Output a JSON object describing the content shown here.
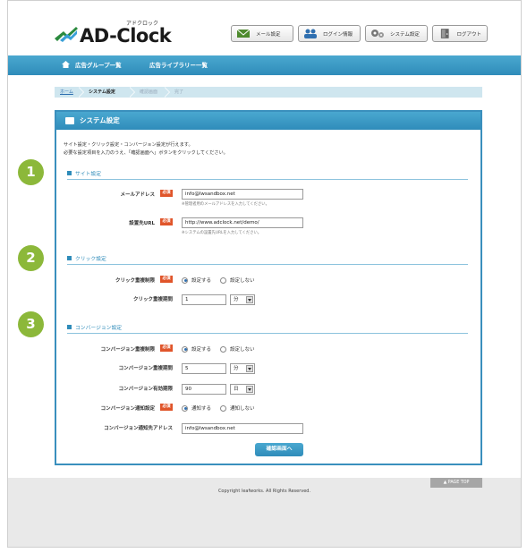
{
  "header": {
    "logo_kana": "アドクロック",
    "logo_text": "AD-Clock",
    "buttons": {
      "mail": "メール設定",
      "login": "ログイン情報",
      "system": "システム設定",
      "logout": "ログアウト"
    }
  },
  "nav": {
    "ad_groups": "広告グループ一覧",
    "ad_library": "広告ライブラリー一覧"
  },
  "breadcrumb": {
    "home": "ホーム",
    "system": "システム設定",
    "confirm": "確認画面",
    "done": "完了"
  },
  "panel": {
    "title": "システム設定",
    "intro_line1": "サイト設定・クリック設定・コンバージョン設定が行えます。",
    "intro_line2": "必要な設定項目を入力のうえ、「確認画面へ」ボタンをクリックしてください。"
  },
  "required_label": "必須",
  "site": {
    "section_title": "サイト設定",
    "mail_label": "メールアドレス",
    "mail_value": "info@lwsandbox.net",
    "mail_note": "※管理者用のメールアドレスを入力してください。",
    "url_label": "設置先URL",
    "url_value": "http://www.adclock.net/demo/",
    "url_note": "※システムの設置先URLを入力してください。"
  },
  "click": {
    "section_title": "クリック設定",
    "dup_label": "クリック重複制限",
    "opt_on": "設定する",
    "opt_off": "設定しない",
    "period_label": "クリック重複期間",
    "period_value": "1",
    "period_unit": "分"
  },
  "conversion": {
    "section_title": "コンバージョン設定",
    "dup_label": "コンバージョン重複制限",
    "opt_on": "設定する",
    "opt_off": "設定しない",
    "period_label": "コンバージョン重複期間",
    "period_value": "5",
    "period_unit": "分",
    "valid_label": "コンバージョン有効期限",
    "valid_value": "90",
    "valid_unit": "日",
    "notify_label": "コンバージョン通知設定",
    "notify_on": "通知する",
    "notify_off": "通知しない",
    "notify_mail_label": "コンバージョン通知先アドレス",
    "notify_mail_value": "info@lwsandbox.net"
  },
  "confirm_button": "確認画面へ",
  "badges": [
    "1",
    "2",
    "3"
  ],
  "footer": {
    "page_top": "▲ PAGE TOP",
    "copyright": "Copyright leafworks. All Rights Reserved."
  },
  "colors": {
    "accent": "#2f8cba",
    "required": "#e0552a",
    "badge": "#8cb83a"
  }
}
